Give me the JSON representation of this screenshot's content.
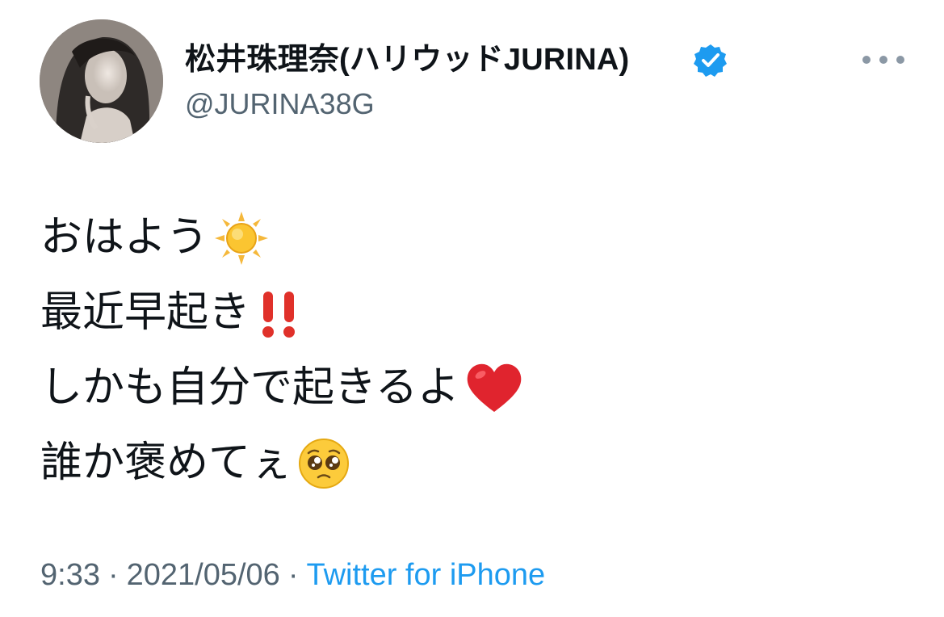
{
  "tweet": {
    "author": {
      "display_name": "松井珠理奈(ハリウッドJURINA)",
      "handle": "@JURINA38G",
      "verified": true,
      "avatar_icon": "profile-photo-icon"
    },
    "more_icon": "more-options-icon",
    "lines": [
      {
        "text": "おはよう",
        "emoji": "sun-icon"
      },
      {
        "text": "最近早起き",
        "emoji": "double-exclamation-icon"
      },
      {
        "text": "しかも自分で起きるよ",
        "emoji": "red-heart-icon"
      },
      {
        "text": "誰か褒めてぇ",
        "emoji": "pleading-face-icon"
      }
    ],
    "time": "9:33",
    "separator": "·",
    "date": "2021/05/06",
    "source": "Twitter for iPhone"
  },
  "colors": {
    "text_primary": "#0f1419",
    "text_secondary": "#536471",
    "link": "#1d9bf0",
    "verified_badge": "#1d9bf0"
  }
}
